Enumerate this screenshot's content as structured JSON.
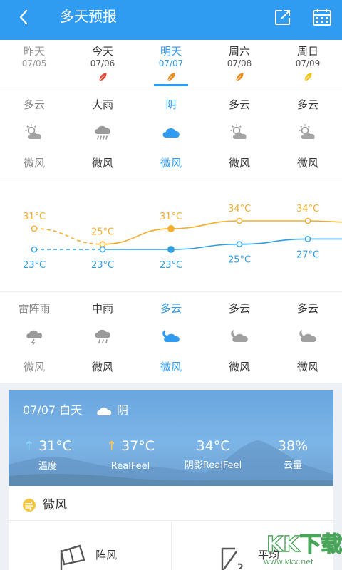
{
  "header": {
    "title": "多天预报",
    "back_icon": "back-arrow-icon",
    "share_icon": "share-icon",
    "calendar_icon": "calendar-icon",
    "color": "#2f9cf2"
  },
  "days": [
    {
      "name": "昨天",
      "date": "07/05",
      "state": "past",
      "leaf": null
    },
    {
      "name": "今天",
      "date": "07/06",
      "state": "normal",
      "leaf": "#e84a3a"
    },
    {
      "name": "明天",
      "date": "07/07",
      "state": "active",
      "leaf": "#f08a1a"
    },
    {
      "name": "周六",
      "date": "07/08",
      "state": "normal",
      "leaf": "#f08a1a"
    },
    {
      "name": "周日",
      "date": "07/09",
      "state": "normal",
      "leaf": "#f2c414"
    }
  ],
  "day_conditions": [
    {
      "condition": "多云",
      "icon": "partly-cloudy-sun-icon",
      "wind": "微风"
    },
    {
      "condition": "大雨",
      "icon": "heavy-rain-icon",
      "wind": "微风"
    },
    {
      "condition": "阴",
      "icon": "overcast-cloud-icon",
      "wind": "微风"
    },
    {
      "condition": "多云",
      "icon": "partly-cloudy-sun-icon",
      "wind": "微风"
    },
    {
      "condition": "多云",
      "icon": "partly-cloudy-sun-icon",
      "wind": "微风"
    }
  ],
  "chart_data": {
    "type": "line",
    "categories": [
      "07/05",
      "07/06",
      "07/07",
      "07/08",
      "07/09"
    ],
    "series": [
      {
        "values": [
          31,
          25,
          31,
          34,
          34
        ],
        "color": "#f2ad2b",
        "labels": [
          "31°C",
          "25°C",
          "31°C",
          "34°C",
          "34°C"
        ]
      },
      {
        "values": [
          23,
          23,
          23,
          25,
          27
        ],
        "color": "#2f9ee0",
        "labels": [
          "23°C",
          "23°C",
          "23°C",
          "25°C",
          "27°C"
        ]
      }
    ],
    "first_segment_dashed": true,
    "active_index": 2
  },
  "night_conditions": [
    {
      "condition": "雷阵雨",
      "icon": "thunderstorm-icon",
      "wind": "微风"
    },
    {
      "condition": "中雨",
      "icon": "rain-icon",
      "wind": "微风"
    },
    {
      "condition": "多云",
      "icon": "partly-cloudy-moon-icon",
      "wind": "微风"
    },
    {
      "condition": "多云",
      "icon": "partly-cloudy-moon-icon",
      "wind": "微风"
    },
    {
      "condition": "多云",
      "icon": "partly-cloudy-moon-icon",
      "wind": "微风"
    }
  ],
  "detail": {
    "date_period": "07/07 白天",
    "condition": "阴",
    "stats": [
      {
        "value": "31°C",
        "label": "温度",
        "arrow": "up-blue"
      },
      {
        "value": "37°C",
        "label": "RealFeel",
        "arrow": "up-yellow"
      },
      {
        "value": "34°C",
        "label": "阴影RealFeel",
        "arrow": null
      },
      {
        "value": "38%",
        "label": "云量",
        "arrow": null
      }
    ],
    "wind_label": "微风",
    "gust_label": "阵风",
    "avg_label": "平均"
  },
  "watermark": "KK下载",
  "watermark_url": "www.kkx.net"
}
